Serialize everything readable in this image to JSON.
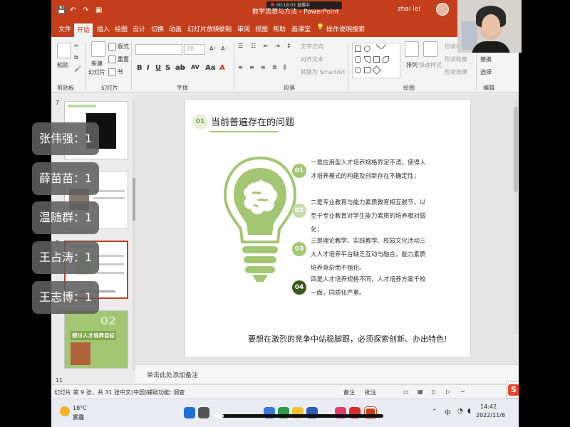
{
  "window": {
    "title": "数学思想与方法 - PowerPoint",
    "user": "zhai lei",
    "recording_time": "00:18:03",
    "recording_label": "直播中"
  },
  "menu": {
    "tabs": [
      "文件",
      "开始",
      "插入",
      "绘图",
      "设计",
      "切换",
      "动画",
      "幻灯片放映",
      "录制",
      "审阅",
      "视图",
      "帮助",
      "画课堂",
      "操作说明搜索"
    ],
    "active": "开始"
  },
  "ribbon": {
    "groups": [
      "剪贴板",
      "幻灯片",
      "字体",
      "段落",
      "绘图",
      "编辑"
    ],
    "clipboard": {
      "paste": "粘贴"
    },
    "slides": {
      "new_slide": "新建",
      "new_slide2": "幻灯片",
      "layout": "版式",
      "reset": "重置",
      "section": "节"
    },
    "font": {
      "size": "20"
    },
    "paragraph": {
      "text_direction": "文字方向",
      "align_text": "对齐文本",
      "smartart": "转换为 SmartArt"
    },
    "drawing": {
      "arrange": "排列",
      "quick_styles": "快速样式",
      "shape_fill": "形状填充",
      "shape_outline": "形状轮廓",
      "shape_effects": "形状效果"
    },
    "editing": {
      "replace": "替换",
      "select": "选择"
    }
  },
  "thumbnails": {
    "numbers": [
      "7",
      "8",
      "9",
      "10",
      "11"
    ],
    "selected": "9",
    "slide10_caption": "探讨人才培养目标",
    "slide10_num": "02"
  },
  "slide": {
    "section_num": "01",
    "title": "当前普遍存在的问题",
    "points": [
      {
        "num": "01",
        "text": "一是应用型人才培养规格界定不清，使得人才培养模式的构建及创新存在不确定性；",
        "color": "#a3c673"
      },
      {
        "num": "02",
        "text": "二是专业教育与能力素质教育相互脱节，以至于专业教育对学生能力素质的培养相对弱化；",
        "color": "#c6dca8"
      },
      {
        "num": "03",
        "text": "三是理论教学、实践教学、校园文化活动三大人才培养平台缺乏互动与融合，能力素质培养竞杂而不强化。",
        "color": "#a3c673"
      },
      {
        "num": "04",
        "text": "四是人才培养规格不同，人才培养方案千校一面，同质化严重。",
        "color": "#3a5a1c"
      }
    ],
    "bottom_text": "要想在激烈的竞争中站稳脚跟，必须探索创新、办出特色!"
  },
  "notes": {
    "placeholder": "单击此处添加备注"
  },
  "status": {
    "slide_pos": "幻灯片 第 9 张，共 31 张",
    "language": "中文(中国)",
    "accessibility": "辅助功能: 调查",
    "notes_btn": "备注",
    "comments_btn": "批注"
  },
  "taskbar": {
    "weather_temp": "18°C",
    "weather_desc": "雾霾",
    "time": "14:42",
    "date": "2022/11/8",
    "ime": "中"
  },
  "participants": [
    "张伟强：1",
    "薛苗苗：1",
    "温随群：1",
    "王占涛：1",
    "王志博：1"
  ],
  "colors": {
    "accent": "#c43e1c",
    "green": "#a3c673",
    "dark_green": "#3a5a1c"
  }
}
